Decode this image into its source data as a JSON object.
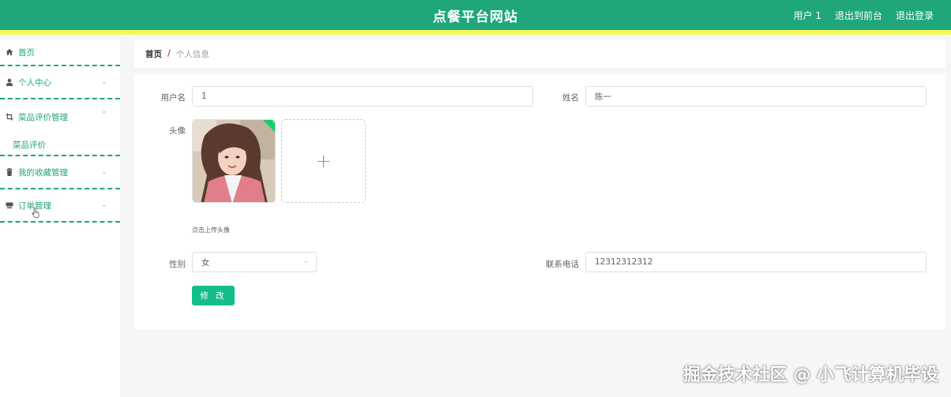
{
  "header": {
    "title": "点餐平台网站",
    "nav": [
      "用户 1",
      "退出到前台",
      "退出登录"
    ],
    "bg_color": "#1fa67a",
    "accent_stripe": "#f2fb54"
  },
  "sidebar": {
    "items": [
      {
        "label": "首页",
        "icon": "home-icon"
      },
      {
        "label": "个人中心",
        "icon": "user-icon"
      },
      {
        "label": "菜品评价管理",
        "icon": "crop-icon",
        "expanded": true,
        "children": [
          "菜品评价"
        ]
      },
      {
        "label": "我的收藏管理",
        "icon": "trash-icon"
      },
      {
        "label": "订单管理",
        "icon": "card-icon"
      }
    ]
  },
  "breadcrumb": {
    "home": "首页",
    "separator": "/",
    "current": "个人信息"
  },
  "form": {
    "username_label": "用户名",
    "username_value": "1",
    "name_label": "姓名",
    "name_value": "陈一",
    "avatar_label": "头像",
    "upload_hint": "点击上传头像",
    "gender_label": "性别",
    "gender_value": "女",
    "phone_label": "联系电话",
    "phone_value": "12312312312",
    "submit_label": "修 改"
  },
  "watermark": "掘金技术社区 @ 小飞计算机毕设"
}
